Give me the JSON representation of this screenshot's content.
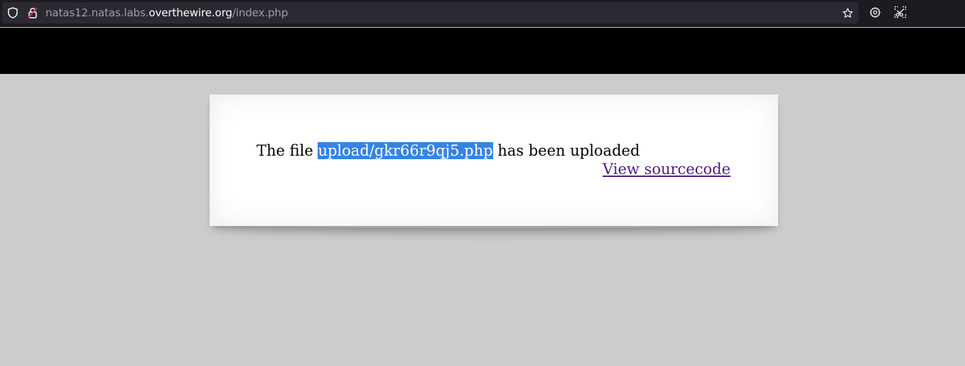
{
  "browser": {
    "url_prefix": "natas12.natas.labs.",
    "url_domain": "overthewire.org",
    "url_path": "/index.php",
    "icons": [
      "shield-icon",
      "insecure-lock-icon",
      "bookmark-star-icon",
      "settings-gear-icon",
      "screenshot-icon"
    ]
  },
  "page": {
    "message_before": "The file ",
    "uploaded_path": "upload/gkr66r9qj5.php",
    "message_after": " has been uploaded",
    "view_source_label": "View sourcecode"
  },
  "colors": {
    "selection": "#3584e4",
    "visited_link": "#551a8b",
    "page_background": "#cccccc",
    "header_background": "#000000"
  }
}
